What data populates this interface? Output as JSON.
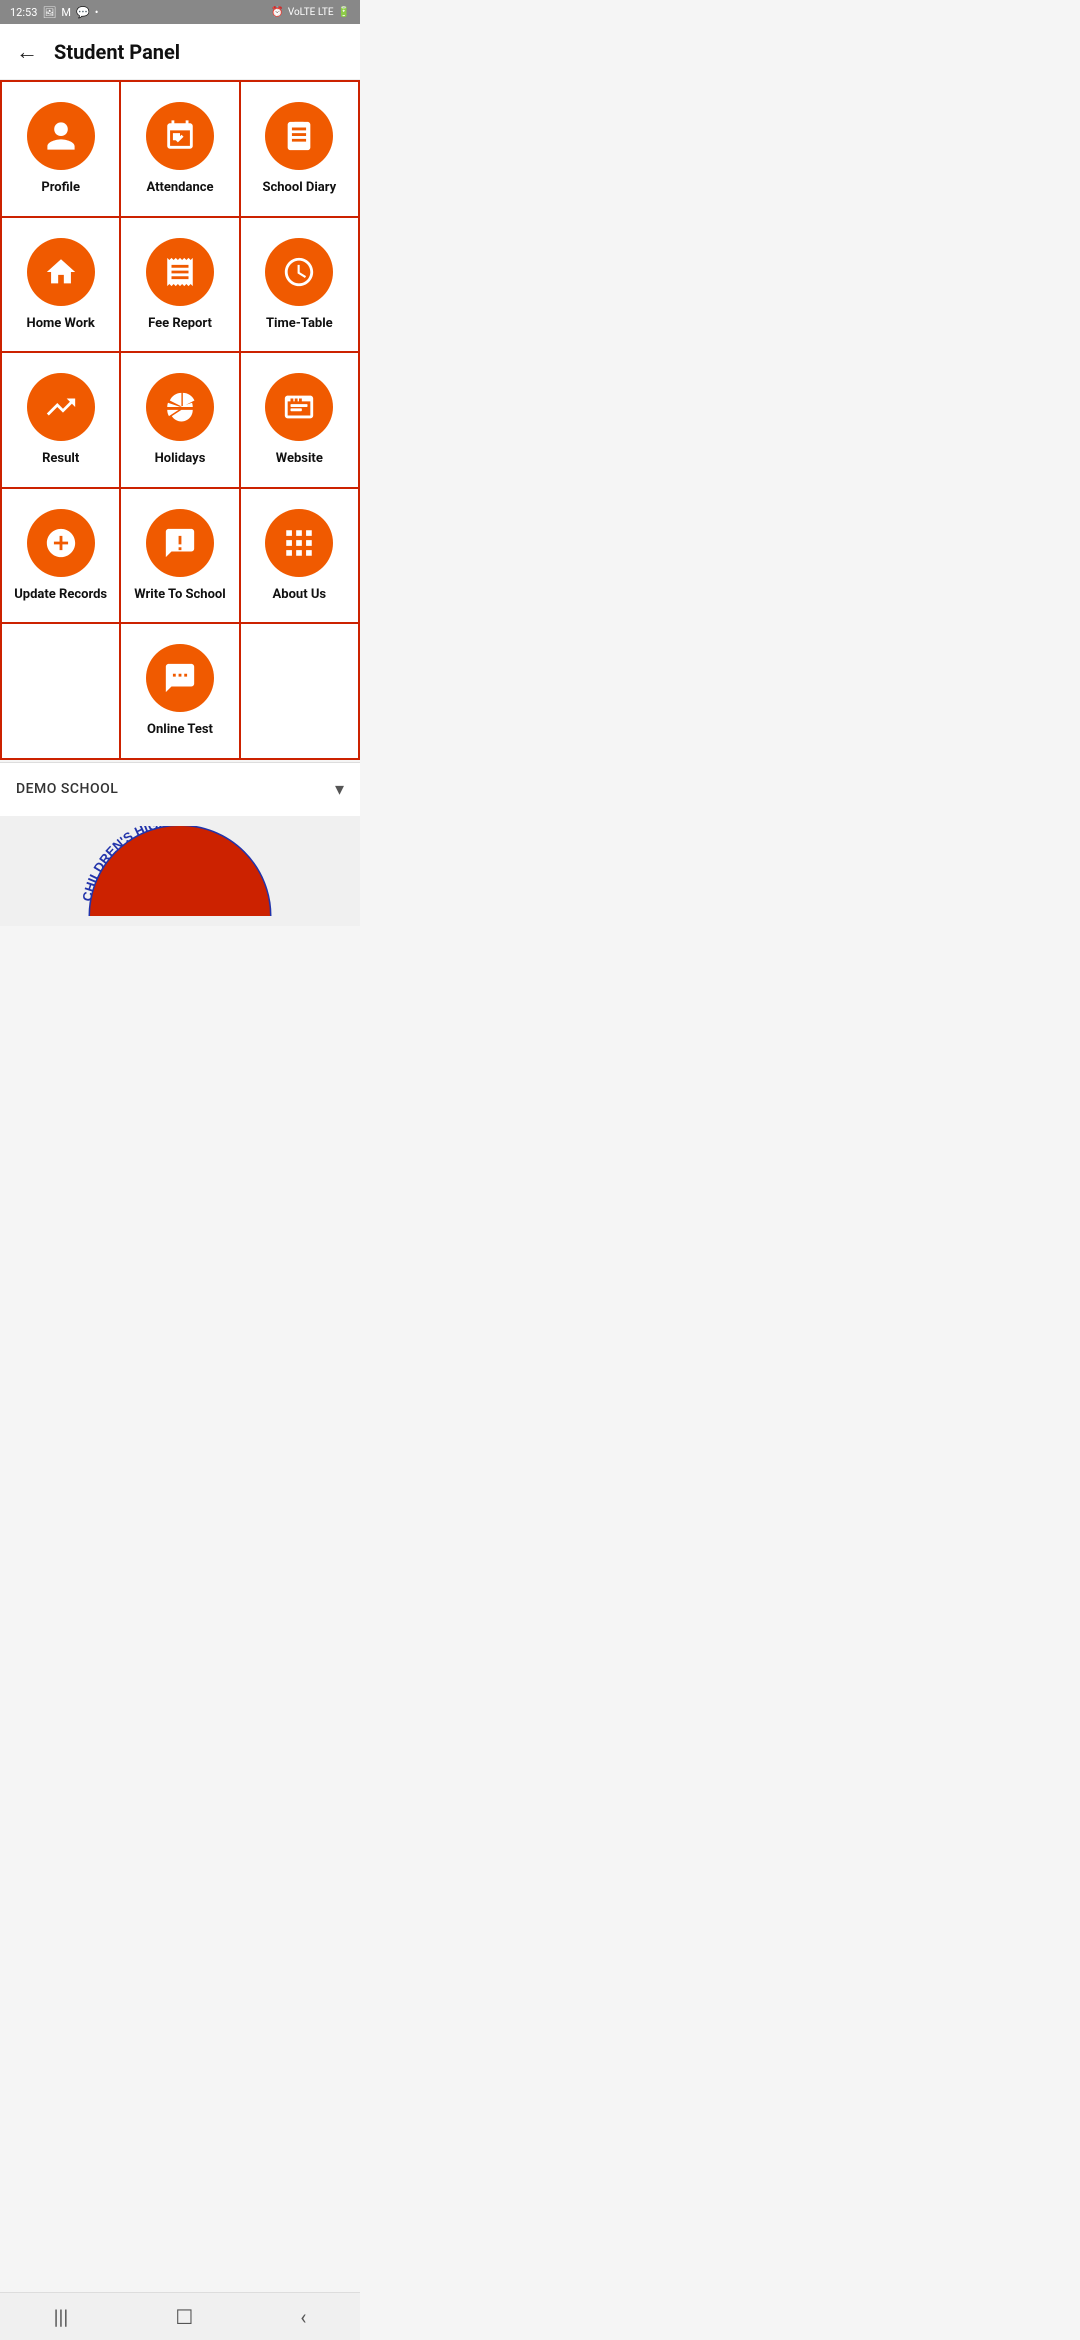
{
  "statusBar": {
    "time": "12:53",
    "icons_left": [
      "photo-icon",
      "mail-icon",
      "message-icon",
      "dot-icon"
    ],
    "icons_right": [
      "alarm-icon",
      "signal-text",
      "battery-icon"
    ]
  },
  "header": {
    "back_label": "←",
    "title": "Student Panel"
  },
  "grid": {
    "items": [
      {
        "id": "profile",
        "label": "Profile",
        "icon": "person"
      },
      {
        "id": "attendance",
        "label": "Attendance",
        "icon": "calendar-check"
      },
      {
        "id": "school-diary",
        "label": "School Diary",
        "icon": "book"
      },
      {
        "id": "home-work",
        "label": "Home Work",
        "icon": "home"
      },
      {
        "id": "fee-report",
        "label": "Fee Report",
        "icon": "receipt"
      },
      {
        "id": "time-table",
        "label": "Time-Table",
        "icon": "clock"
      },
      {
        "id": "result",
        "label": "Result",
        "icon": "trending-up"
      },
      {
        "id": "holidays",
        "label": "Holidays",
        "icon": "umbrella-beach"
      },
      {
        "id": "website",
        "label": "Website",
        "icon": "browser"
      },
      {
        "id": "update-records",
        "label": "Update Records",
        "icon": "plus-circle"
      },
      {
        "id": "write-to-school",
        "label": "Write To School",
        "icon": "message-exclaim"
      },
      {
        "id": "about-us",
        "label": "About Us",
        "icon": "grid-dots"
      },
      {
        "id": "empty-left",
        "label": "",
        "icon": "none",
        "empty": true
      },
      {
        "id": "online-test",
        "label": "Online Test",
        "icon": "chat-bubble"
      },
      {
        "id": "empty-right",
        "label": "",
        "icon": "none",
        "empty": true
      }
    ]
  },
  "footer": {
    "school_name": "DEMO SCHOOL",
    "dropdown_label": "DEMO SCHOOL"
  },
  "nav": {
    "items": [
      "|||",
      "☐",
      "<"
    ]
  },
  "logo": {
    "text": "CHILDREN'S HIGH"
  }
}
